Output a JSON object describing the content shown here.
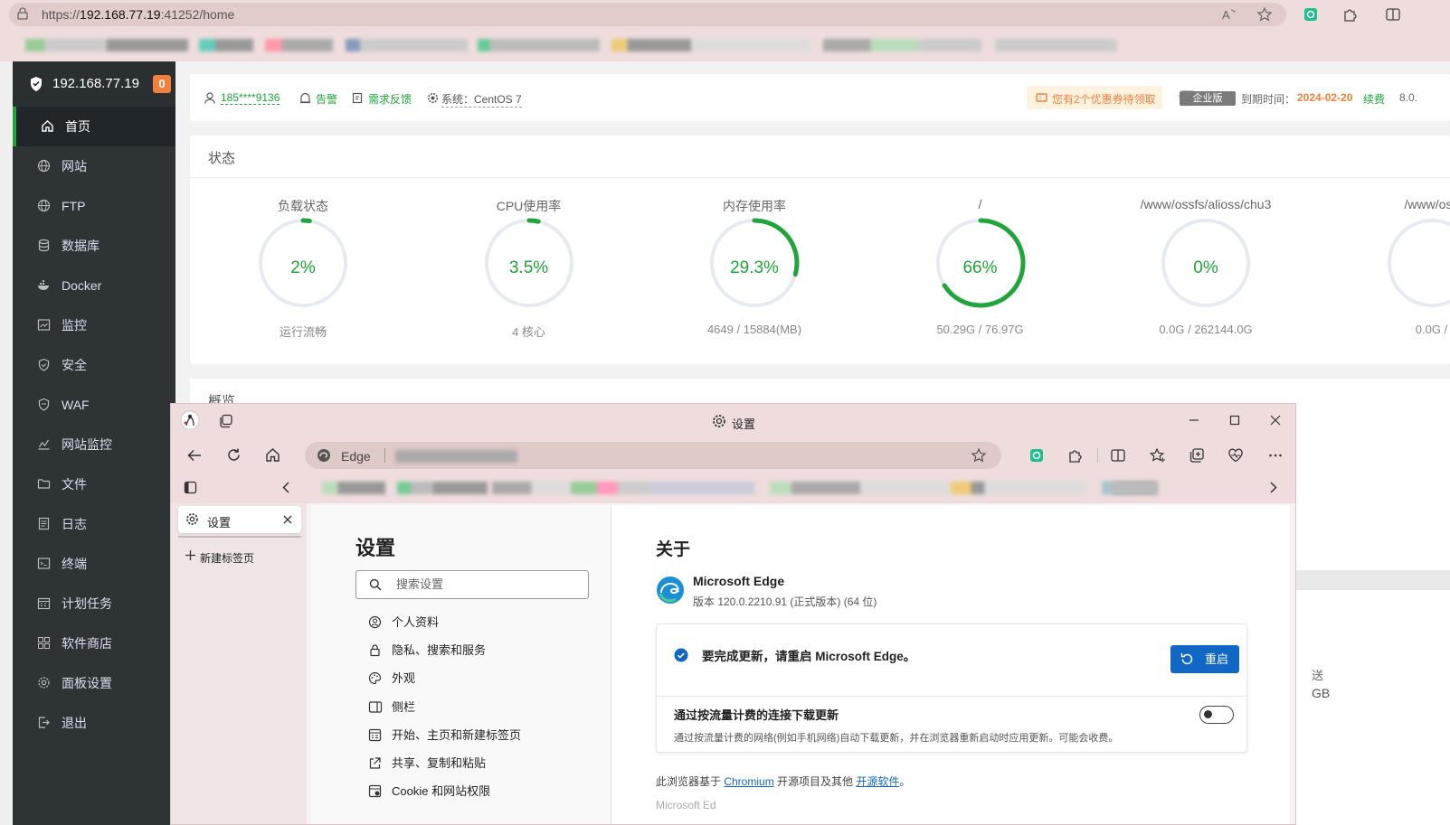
{
  "outer_browser": {
    "url_prefix": "https://",
    "url_host": "192.168.77.19",
    "url_suffix": ":41252/home"
  },
  "panel": {
    "sidebar": {
      "host": "192.168.77.19",
      "badge": "0",
      "items": [
        {
          "label": "首页",
          "icon": "home-icon"
        },
        {
          "label": "网站",
          "icon": "globe-icon"
        },
        {
          "label": "FTP",
          "icon": "globe-icon"
        },
        {
          "label": "数据库",
          "icon": "database-icon"
        },
        {
          "label": "Docker",
          "icon": "docker-icon"
        },
        {
          "label": "监控",
          "icon": "monitor-icon"
        },
        {
          "label": "安全",
          "icon": "shield-icon"
        },
        {
          "label": "WAF",
          "icon": "shield-icon"
        },
        {
          "label": "网站监控",
          "icon": "chart-icon"
        },
        {
          "label": "文件",
          "icon": "folder-icon"
        },
        {
          "label": "日志",
          "icon": "log-icon"
        },
        {
          "label": "终端",
          "icon": "terminal-icon"
        },
        {
          "label": "计划任务",
          "icon": "calendar-icon"
        },
        {
          "label": "软件商店",
          "icon": "grid-icon"
        },
        {
          "label": "面板设置",
          "icon": "gear-icon"
        },
        {
          "label": "退出",
          "icon": "logout-icon"
        }
      ]
    },
    "topbar": {
      "user": "185****9136",
      "alarm": "告警",
      "feedback": "需求反馈",
      "system": "系统：CentOS 7",
      "coupon": "您有2个优惠券待领取",
      "edition": "企业版",
      "expire_label": "到期时间：",
      "expire_date": "2024-02-20",
      "renew": "续费",
      "version": "8.0."
    },
    "status": {
      "title": "状态",
      "gauges": [
        {
          "label": "负载状态",
          "value": "2%",
          "sub": "运行流畅",
          "percent": 2
        },
        {
          "label": "CPU使用率",
          "value": "3.5%",
          "sub": "4 核心",
          "percent": 3.5
        },
        {
          "label": "内存使用率",
          "value": "29.3%",
          "sub": "4649 / 15884(MB)",
          "percent": 29.3
        },
        {
          "label": "/",
          "value": "66%",
          "sub": "50.29G / 76.97G",
          "percent": 66
        },
        {
          "label": "/www/ossfs/alioss/chu3",
          "value": "0%",
          "sub": "0.0G / 262144.0G",
          "percent": 0
        },
        {
          "label": "/www/oss",
          "value": "",
          "sub": "0.0G /",
          "percent": 0
        }
      ]
    },
    "overview": {
      "title": "概览",
      "partial_a": "送",
      "partial_b": "GB"
    }
  },
  "edge_window": {
    "title": "设置",
    "address_label": "Edge",
    "vertical_tabs": {
      "active": "设置",
      "new_tab": "新建标签页"
    },
    "settings_nav": {
      "title": "设置",
      "search_placeholder": "搜索设置",
      "items": [
        {
          "label": "个人资料",
          "icon": "profile-icon"
        },
        {
          "label": "隐私、搜索和服务",
          "icon": "lock-icon"
        },
        {
          "label": "外观",
          "icon": "palette-icon"
        },
        {
          "label": "侧栏",
          "icon": "sidebar-icon"
        },
        {
          "label": "开始、主页和新建标签页",
          "icon": "home-page-icon"
        },
        {
          "label": "共享、复制和粘贴",
          "icon": "share-icon"
        },
        {
          "label": "Cookie 和网站权限",
          "icon": "cookie-icon"
        }
      ]
    },
    "about": {
      "title": "关于",
      "product": "Microsoft Edge",
      "version": "版本 120.0.2210.91 (正式版本) (64 位)",
      "update_message": "要完成更新，请重启 Microsoft Edge。",
      "restart_button": "重启",
      "metered_title": "通过按流量计费的连接下载更新",
      "metered_desc": "通过按流量计费的网络(例如手机网络)自动下载更新，并在浏览器重新启动时应用更新。可能会收费。",
      "metered_enabled": false,
      "footer_prefix": "此浏览器基于 ",
      "footer_link1": "Chromium",
      "footer_middle": " 开源项目及其他 ",
      "footer_link2": "开源软件",
      "footer_suffix": "。",
      "footer_cut": "Microsoft Ed"
    }
  },
  "colors": {
    "accent": "#20a53a",
    "sidebar_bg": "#2e3436",
    "edge_blue": "#1168c4",
    "warn": "#f0803c",
    "titlebar": "#efdddd"
  }
}
